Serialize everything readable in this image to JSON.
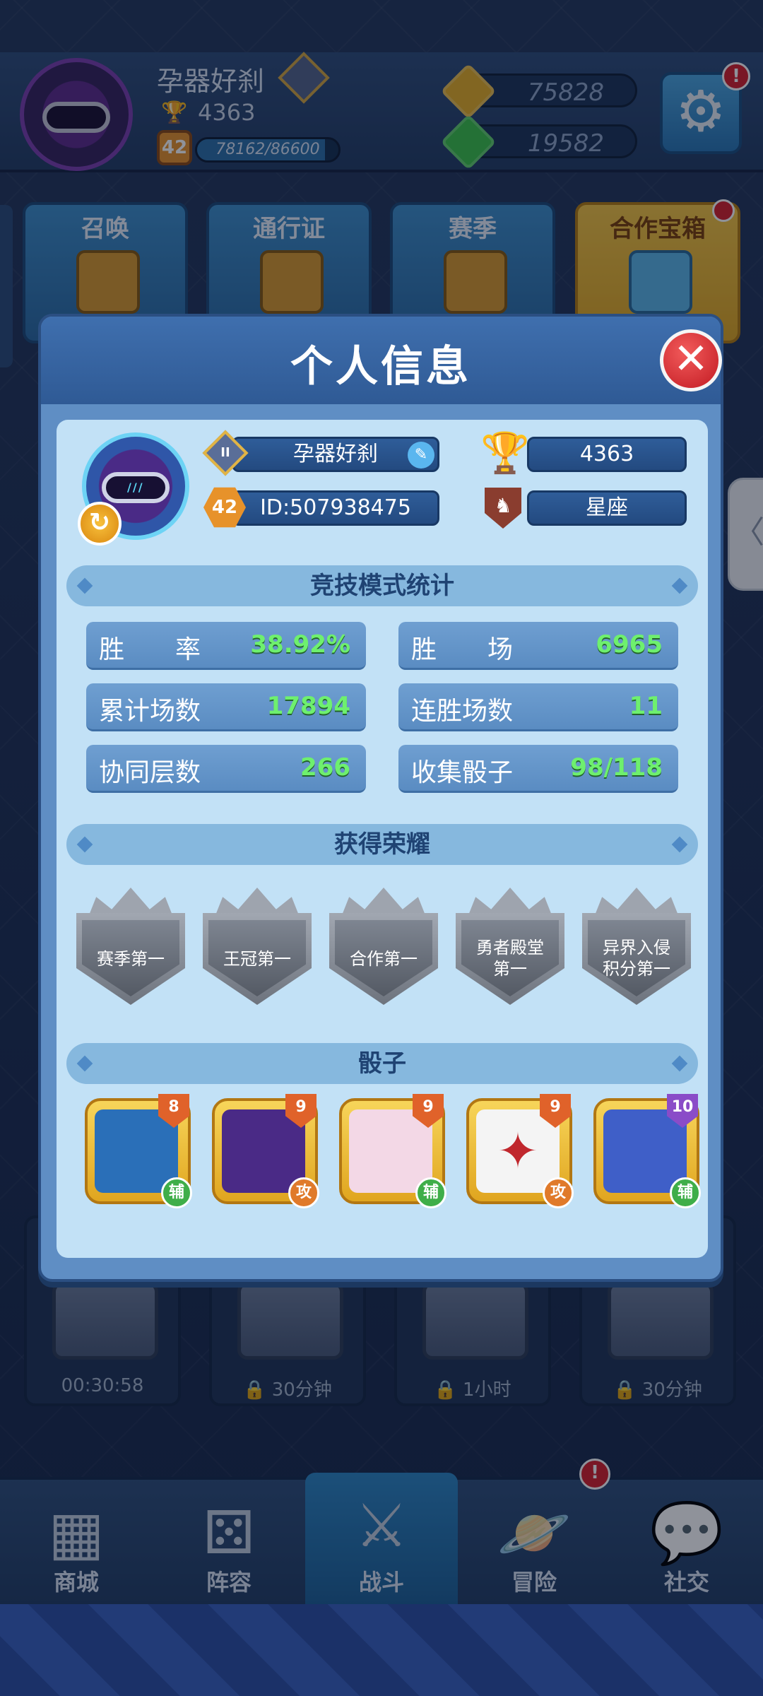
{
  "background": {
    "player": {
      "name": "孕器好刹",
      "trophies": "4363",
      "level": "42",
      "xp_text": "78162/86600",
      "xp_progress": 0.9026
    },
    "currencies": [
      {
        "name": "gold",
        "value": "75828",
        "color": "#e8b026"
      },
      {
        "name": "gems",
        "value": "19582",
        "color": "#3cc44a"
      }
    ],
    "settings_badge": "!",
    "menu_tiles": [
      {
        "label": "召唤"
      },
      {
        "label": "通行证"
      },
      {
        "label": "赛季"
      },
      {
        "label": "合作宝箱"
      }
    ],
    "chest_slots": [
      {
        "time": "00:30:58",
        "locked": false
      },
      {
        "time": "30分钟",
        "locked": true
      },
      {
        "time": "1小时",
        "locked": true
      },
      {
        "time": "30分钟",
        "locked": true
      }
    ],
    "nav": [
      {
        "label": "商城",
        "icon": "shop-icon"
      },
      {
        "label": "阵容",
        "icon": "dice-icon"
      },
      {
        "label": "战斗",
        "icon": "swords-icon"
      },
      {
        "label": "冒险",
        "icon": "planet-icon"
      },
      {
        "label": "社交",
        "icon": "chat-icon"
      }
    ],
    "nav_adventure_badge": "!"
  },
  "modal": {
    "title": "个人信息",
    "close_icon": "close-icon",
    "profile": {
      "name": "孕器好刹",
      "trophies": "4363",
      "level": "42",
      "id_text": "ID:507938475",
      "constellation": "星座"
    },
    "sections": {
      "stats_title": "竞技模式统计",
      "honors_title": "获得荣耀",
      "dice_title": "骰子"
    },
    "stats": [
      {
        "label": "胜　　率",
        "value": "38.92%"
      },
      {
        "label": "胜　　场",
        "value": "6965"
      },
      {
        "label": "累计场数",
        "value": "17894"
      },
      {
        "label": "连胜场数",
        "value": "11"
      },
      {
        "label": "协同层数",
        "value": "266"
      },
      {
        "label": "收集骰子",
        "value": "98/118"
      }
    ],
    "honors": [
      {
        "label": "赛季第一"
      },
      {
        "label": "王冠第一"
      },
      {
        "label": "合作第一"
      },
      {
        "label": "勇者殿堂第一"
      },
      {
        "label": "异界入侵积分第一"
      }
    ],
    "dice": [
      {
        "level": "8",
        "role": "辅",
        "art_color": "#2a6fb8",
        "level_color": "#e0622a",
        "role_color": "#3fae49"
      },
      {
        "level": "9",
        "role": "攻",
        "art_color": "#4a2a86",
        "level_color": "#e0622a",
        "role_color": "#e07a2a"
      },
      {
        "level": "9",
        "role": "辅",
        "art_color": "#f3d8e6",
        "level_color": "#e0622a",
        "role_color": "#3fae49"
      },
      {
        "level": "9",
        "role": "攻",
        "art_color": "#f4f4f4",
        "level_color": "#e0622a",
        "role_color": "#e07a2a"
      },
      {
        "level": "10",
        "role": "辅",
        "art_color": "#3f5fc8",
        "level_color": "#8a4cc8",
        "role_color": "#3fae49"
      }
    ]
  }
}
